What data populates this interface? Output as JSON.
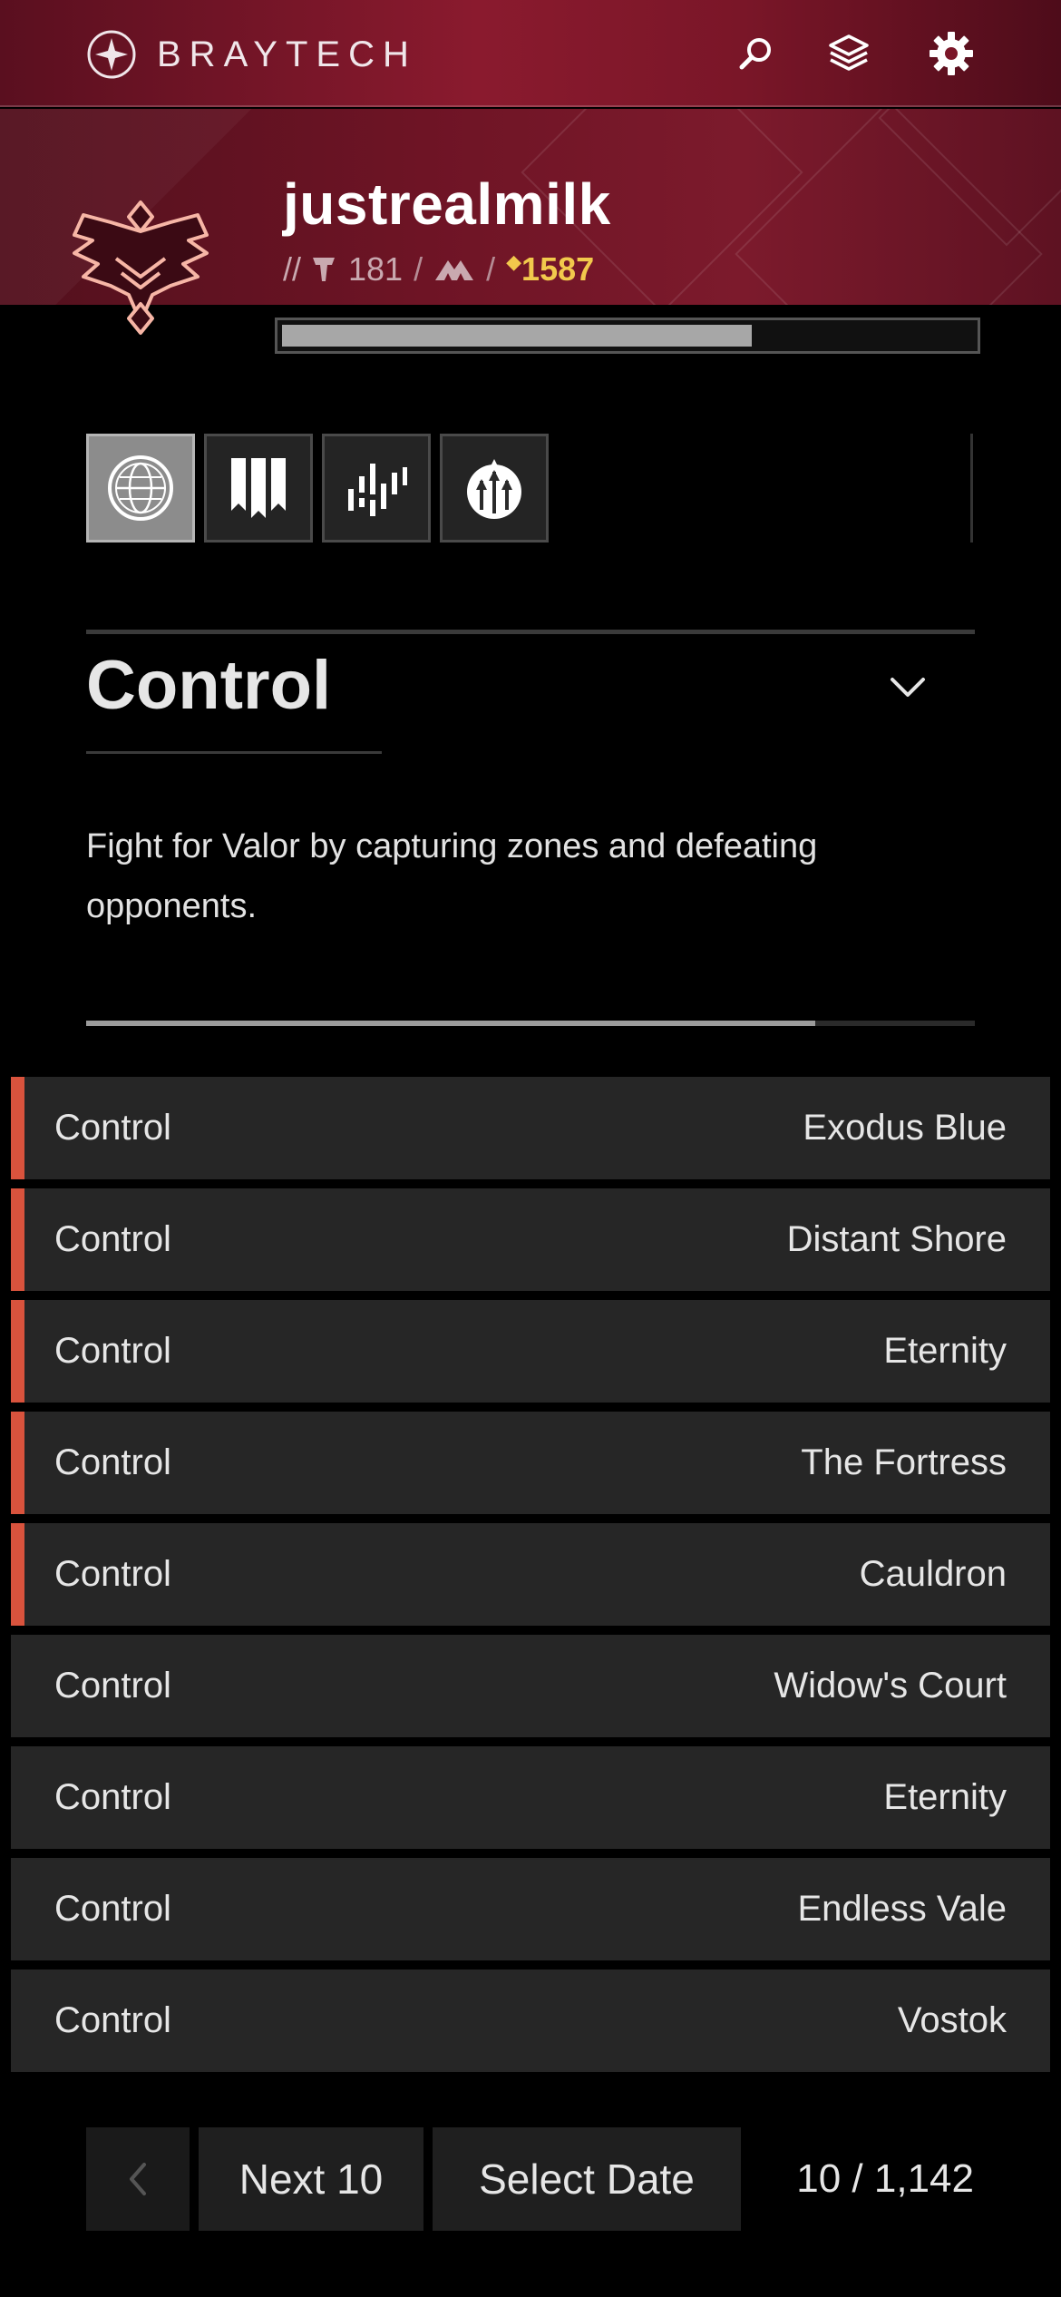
{
  "header": {
    "brand": "BRAYTECH",
    "icons": [
      "search-icon",
      "layers-icon",
      "gear-icon"
    ]
  },
  "profile": {
    "username": "justrealmilk",
    "prefix": "//",
    "level": "181",
    "light": "1587",
    "xp_progress": 0.68
  },
  "modes": {
    "tabs": [
      "globe-icon",
      "banners-icon",
      "bars-icon",
      "trials-icon"
    ],
    "active_index": 0
  },
  "section": {
    "title": "Control",
    "description": "Fight for Valor by capturing zones and defeating opponents.",
    "progress": 0.82
  },
  "matches": [
    {
      "mode": "Control",
      "map": "Exodus Blue",
      "marked": true
    },
    {
      "mode": "Control",
      "map": "Distant Shore",
      "marked": true
    },
    {
      "mode": "Control",
      "map": "Eternity",
      "marked": true
    },
    {
      "mode": "Control",
      "map": "The Fortress",
      "marked": true
    },
    {
      "mode": "Control",
      "map": "Cauldron",
      "marked": true
    },
    {
      "mode": "Control",
      "map": "Widow's Court",
      "marked": false
    },
    {
      "mode": "Control",
      "map": "Eternity",
      "marked": false
    },
    {
      "mode": "Control",
      "map": "Endless Vale",
      "marked": false
    },
    {
      "mode": "Control",
      "map": "Vostok",
      "marked": false
    }
  ],
  "pager": {
    "prev_icon": "chevron-left-icon",
    "next_label": "Next 10",
    "date_label": "Select Date",
    "count": "10 / 1,142"
  },
  "colors": {
    "accent_red": "#d9533d",
    "light_gold": "#f2c94c",
    "header_crimson": "#8a1a2e"
  }
}
